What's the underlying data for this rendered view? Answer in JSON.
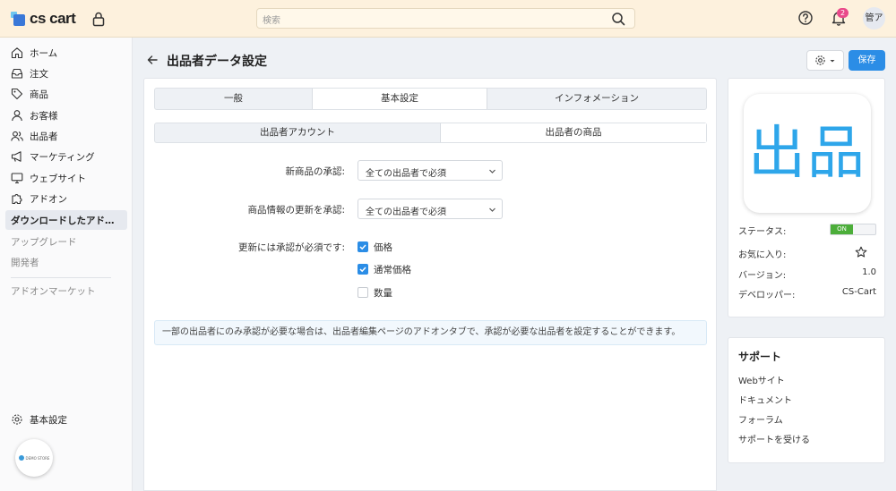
{
  "header": {
    "logo_text": "cs cart",
    "search_placeholder": "検索",
    "notification_count": "2",
    "avatar_initials": "管ア"
  },
  "sidebar": {
    "items": [
      {
        "label": "ホーム",
        "icon": "home-icon"
      },
      {
        "label": "注文",
        "icon": "inbox-icon"
      },
      {
        "label": "商品",
        "icon": "tag-icon"
      },
      {
        "label": "お客様",
        "icon": "user-icon"
      },
      {
        "label": "出品者",
        "icon": "users-icon"
      },
      {
        "label": "マーケティング",
        "icon": "megaphone-icon"
      },
      {
        "label": "ウェブサイト",
        "icon": "monitor-icon"
      },
      {
        "label": "アドオン",
        "icon": "puzzle-icon"
      },
      {
        "label": "ダウンロードしたアド…",
        "icon": ""
      },
      {
        "label": "アップグレード",
        "icon": ""
      },
      {
        "label": "開発者",
        "icon": ""
      },
      {
        "label": "アドオンマーケット",
        "icon": ""
      }
    ],
    "settings_label": "基本設定",
    "demo_badge_text": "DEMO STORE"
  },
  "page": {
    "title": "出品者データ設定",
    "save_label": "保存"
  },
  "tabs": [
    "一般",
    "基本設定",
    "インフォメーション"
  ],
  "subtabs": [
    "出品者アカウント",
    "出品者の商品"
  ],
  "form": {
    "new_product_label": "新商品の承認:",
    "new_product_value": "全ての出品者で必須",
    "update_label": "商品情報の更新を承認:",
    "update_value": "全ての出品者で必須",
    "required_label": "更新には承認が必須です:",
    "checkboxes": [
      {
        "label": "価格",
        "checked": true
      },
      {
        "label": "通常価格",
        "checked": true
      },
      {
        "label": "数量",
        "checked": false
      }
    ]
  },
  "notice": "一部の出品者にのみ承認が必要な場合は、出品者編集ページのアドオンタブで、承認が必要な出品者を設定することができます。",
  "addon_info": {
    "image_text": "出品",
    "status_label": "ステータス:",
    "status_value": "ON",
    "favorite_label": "お気に入り:",
    "version_label": "バージョン:",
    "version_value": "1.0",
    "developer_label": "デベロッパー:",
    "developer_value": "CS-Cart"
  },
  "support": {
    "title": "サポート",
    "links": [
      "Webサイト",
      "ドキュメント",
      "フォーラム",
      "サポートを受ける"
    ]
  },
  "colors": {
    "accent": "#2b8de6",
    "header_bg": "#fdf1dd",
    "toggle_on": "#4cae3a",
    "badge": "#e94a8a"
  }
}
